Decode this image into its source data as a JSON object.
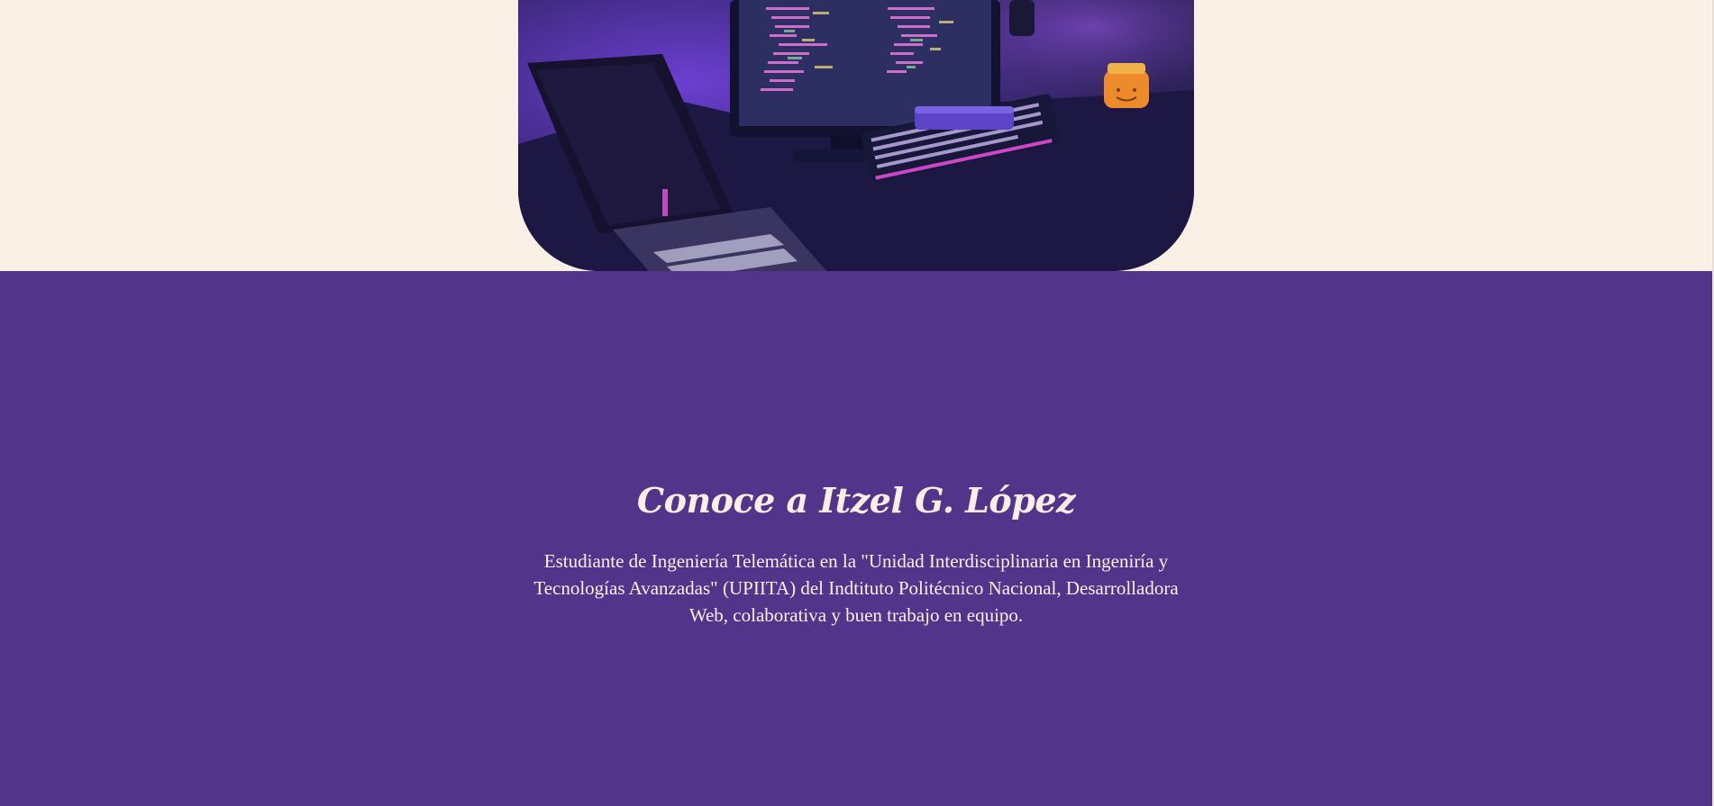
{
  "hero": {
    "image_alt": "Computadora con código en pantalla, teclado iluminado y laptop en un escritorio"
  },
  "about": {
    "title": "Conoce a Itzel G. López",
    "description": "Estudiante de Ingeniería Telemática en la \"Unidad Interdisciplinaria en Ingeniría y Tecnologías Avanzadas\" (UPIITA) del Indtituto Politécnico Nacional, Desarrolladora Web, colaborativa y buen trabajo en equipo."
  },
  "colors": {
    "page_background": "#faf0e6",
    "section_background": "#52358b",
    "text_light": "#fbefe6"
  }
}
